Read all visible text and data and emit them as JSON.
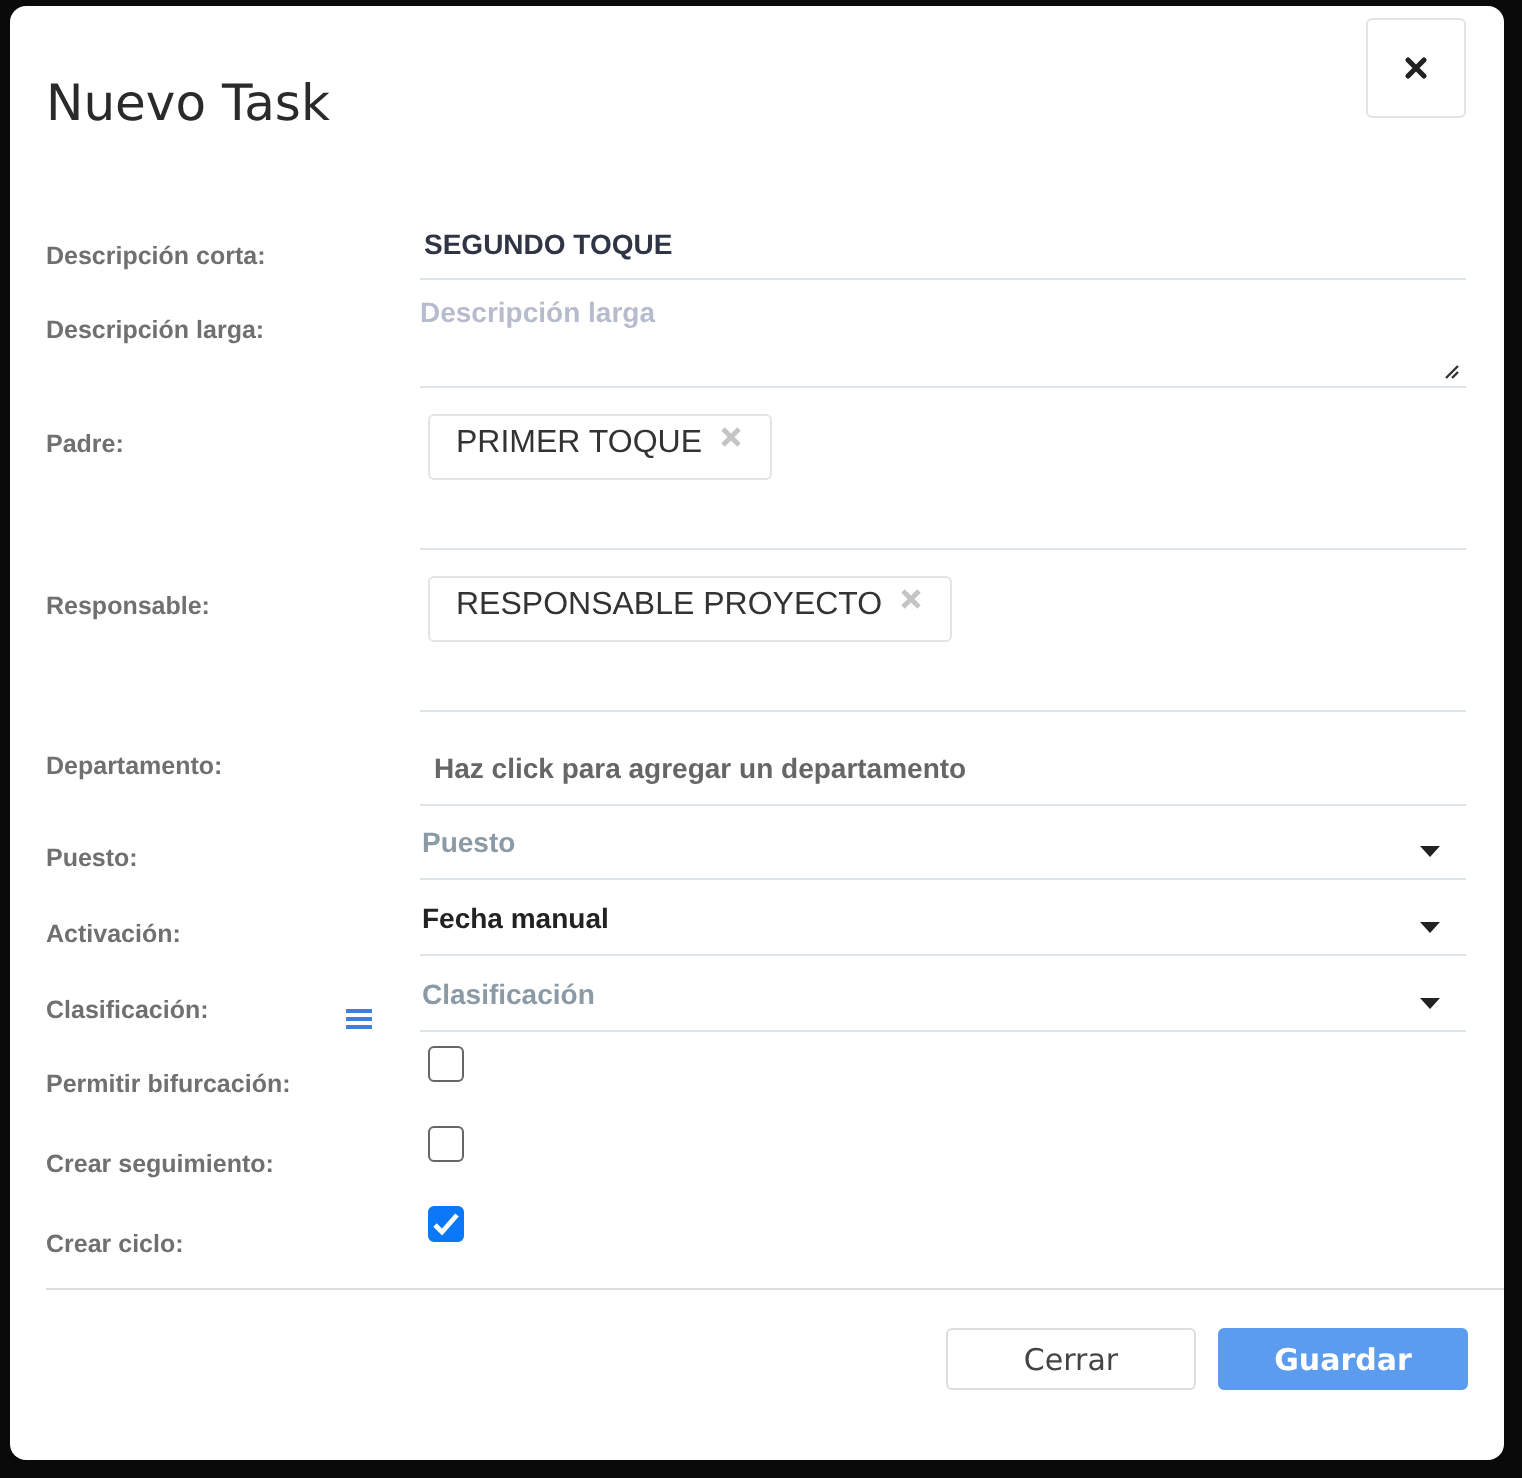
{
  "dialog": {
    "title": "Nuevo Task"
  },
  "fields": [
    {
      "label": "Descripción corta:",
      "kind": "text",
      "value": "SEGUNDO TOQUE"
    },
    {
      "label": "Descripción larga:",
      "kind": "textarea",
      "placeholder": "Descripción larga"
    },
    {
      "label": "Padre:",
      "kind": "tags",
      "tags": [
        "PRIMER TOQUE"
      ]
    },
    {
      "label": "Responsable:",
      "kind": "tags",
      "tags": [
        "RESPONSABLE PROYECTO"
      ]
    },
    {
      "label": "Departamento:",
      "kind": "link",
      "text": "Haz click para agregar un departamento"
    },
    {
      "label": "Puesto:",
      "kind": "select",
      "placeholder": "Puesto",
      "has_menu": false
    },
    {
      "label": "Activación:",
      "kind": "select",
      "value": "Fecha manual",
      "has_menu": false
    },
    {
      "label": "Clasificación:",
      "kind": "select",
      "placeholder": "Clasificación",
      "has_menu": true
    },
    {
      "label": "Permitir bifurcación:",
      "kind": "checkbox",
      "checked": false
    },
    {
      "label": "Crear seguimiento:",
      "kind": "checkbox",
      "checked": false
    },
    {
      "label": "Crear ciclo:",
      "kind": "checkbox",
      "checked": true
    }
  ],
  "buttons": [
    {
      "label": "Cerrar",
      "kind": "secondary"
    },
    {
      "label": "Guardar",
      "kind": "primary"
    }
  ]
}
